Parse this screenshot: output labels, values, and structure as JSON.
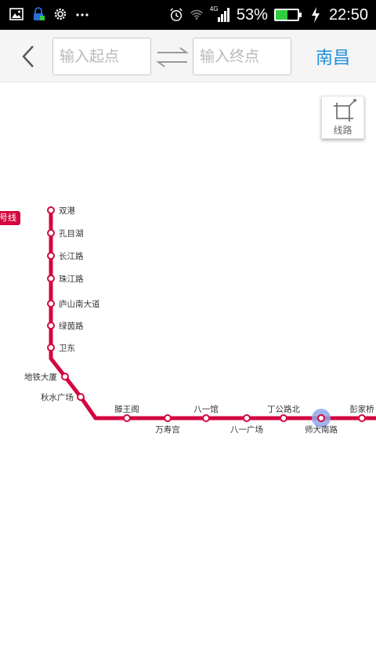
{
  "status_bar": {
    "network": "4G",
    "battery_percent": "53%",
    "battery_level": 0.53,
    "time": "22:50",
    "icons": [
      "image-icon",
      "lock-icon",
      "settings-icon",
      "more-icon",
      "alarm-icon",
      "wifi-icon",
      "signal-icon",
      "battery-icon",
      "charging-icon"
    ]
  },
  "header": {
    "back_icon": "chevron-left-icon",
    "start_placeholder": "输入起点",
    "end_placeholder": "输入终点",
    "swap_icon": "swap-arrows-icon",
    "city": "南昌"
  },
  "map": {
    "route_button_label": "线路",
    "line_badge": "号线",
    "line_color": "#d3063f",
    "highlight_color": "#8ea8e8",
    "stations": [
      {
        "name": "双港"
      },
      {
        "name": "孔目湖"
      },
      {
        "name": "长江路"
      },
      {
        "name": "珠江路"
      },
      {
        "name": "庐山南大道"
      },
      {
        "name": "绿茵路"
      },
      {
        "name": "卫东"
      },
      {
        "name": "地铁大厦"
      },
      {
        "name": "秋水广场"
      },
      {
        "name": "滕王阁"
      },
      {
        "name": "万寿宫"
      },
      {
        "name": "八一馆"
      },
      {
        "name": "八一广场"
      },
      {
        "name": "丁公路北"
      },
      {
        "name": "师大南路",
        "selected": true
      },
      {
        "name": "彭家桥"
      }
    ]
  }
}
